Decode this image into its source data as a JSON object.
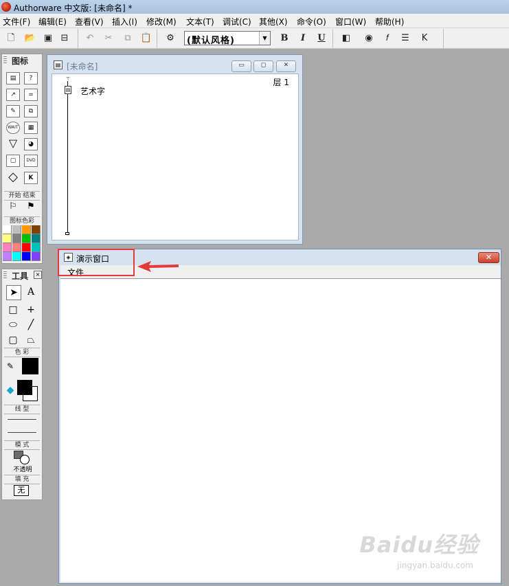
{
  "app": {
    "title": "Authorware 中文版: [未命名] *"
  },
  "menubar": {
    "items": [
      "文件(F)",
      "编辑(E)",
      "查看(V)",
      "插入(I)",
      "修改(M)",
      "文本(T)",
      "调试(C)",
      "其他(X)",
      "命令(O)",
      "窗口(W)",
      "帮助(H)"
    ]
  },
  "toolbar": {
    "style_select_value": "(默认风格)",
    "bold_label": "B",
    "italic_label": "I",
    "underline_label": "U"
  },
  "icons_palette": {
    "title": "图标",
    "start_label": "开始",
    "end_label": "结束",
    "color_label": "图标色彩",
    "icon_names": [
      "display-icon",
      "interaction-icon",
      "motion-icon",
      "calculation-icon",
      "erase-icon",
      "map-icon",
      "wait-icon",
      "digital-movie-icon",
      "navigate-icon",
      "sound-icon",
      "framework-icon",
      "video-icon",
      "decision-icon",
      "knowledge-object-icon"
    ],
    "swatch_colors": [
      "#ffffff",
      "#c0c0c0",
      "#ff9900",
      "#804000",
      "#ffff80",
      "#808080",
      "#00c000",
      "#008080",
      "#ff80c0",
      "#ff8080",
      "#ff0000",
      "#00c0c0",
      "#c080ff",
      "#00ffff",
      "#0000ff",
      "#8040ff"
    ]
  },
  "tools_palette": {
    "title": "工具",
    "color_label": "色 彩",
    "line_label": "线 型",
    "mode_label": "模 式",
    "mode_value": "不透明",
    "fill_label": "填 充",
    "fill_value": "无",
    "text_tool": "A"
  },
  "flow_window": {
    "title": "[未命名]",
    "level_label": "层 1",
    "icon_label": "艺术字"
  },
  "demo_window": {
    "title": "演示窗口",
    "menu_file": "文件"
  },
  "watermark": {
    "text": "Baidu经验",
    "url": "jingyan.baidu.com"
  }
}
